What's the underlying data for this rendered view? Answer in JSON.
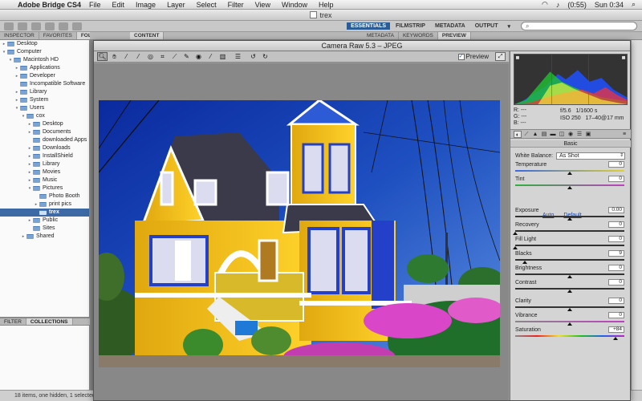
{
  "menubar": {
    "app": "Adobe Bridge CS4",
    "items": [
      "File",
      "Edit",
      "Image",
      "Layer",
      "Select",
      "Filter",
      "View",
      "Window",
      "Help"
    ],
    "battery": "(0:55)",
    "clock": "Sun 0:34"
  },
  "bridge": {
    "window_title": "trex",
    "workspaces": [
      "ESSENTIALS",
      "FILMSTRIP",
      "METADATA",
      "OUTPUT"
    ],
    "search_placeholder": "",
    "left_tabs": [
      "INSPECTOR",
      "FAVORITES",
      "FOLDERS"
    ],
    "content_tab": "CONTENT",
    "right_tabs": [
      "METADATA",
      "KEYWORDS",
      "PREVIEW"
    ],
    "bottom_tabs": [
      "FILTER",
      "COLLECTIONS"
    ],
    "status": "18 items, one hidden, 1 selected -"
  },
  "folders": [
    {
      "label": "Desktop",
      "depth": 0,
      "tri": "▸"
    },
    {
      "label": "Computer",
      "depth": 0,
      "tri": "▾"
    },
    {
      "label": "Macintosh HD",
      "depth": 1,
      "tri": "▾"
    },
    {
      "label": "Applications",
      "depth": 2,
      "tri": "▸"
    },
    {
      "label": "Developer",
      "depth": 2,
      "tri": "▸"
    },
    {
      "label": "Incompatible Software",
      "depth": 2,
      "tri": ""
    },
    {
      "label": "Library",
      "depth": 2,
      "tri": "▸"
    },
    {
      "label": "System",
      "depth": 2,
      "tri": "▸"
    },
    {
      "label": "Users",
      "depth": 2,
      "tri": "▾"
    },
    {
      "label": "cox",
      "depth": 3,
      "tri": "▾"
    },
    {
      "label": "Desktop",
      "depth": 4,
      "tri": "▸"
    },
    {
      "label": "Documents",
      "depth": 4,
      "tri": "▸"
    },
    {
      "label": "downloaded Apps",
      "depth": 4,
      "tri": ""
    },
    {
      "label": "Downloads",
      "depth": 4,
      "tri": "▸"
    },
    {
      "label": "InstallShield",
      "depth": 4,
      "tri": "▸"
    },
    {
      "label": "Library",
      "depth": 4,
      "tri": "▸"
    },
    {
      "label": "Movies",
      "depth": 4,
      "tri": "▸"
    },
    {
      "label": "Music",
      "depth": 4,
      "tri": "▸"
    },
    {
      "label": "Pictures",
      "depth": 4,
      "tri": "▾"
    },
    {
      "label": "Photo Booth",
      "depth": 5,
      "tri": ""
    },
    {
      "label": "print pics",
      "depth": 5,
      "tri": "▸"
    },
    {
      "label": "trex",
      "depth": 5,
      "tri": "",
      "selected": true
    },
    {
      "label": "Public",
      "depth": 4,
      "tri": "▸"
    },
    {
      "label": "Sites",
      "depth": 4,
      "tri": ""
    },
    {
      "label": "Shared",
      "depth": 3,
      "tri": "▸"
    }
  ],
  "camera_raw": {
    "title": "Camera Raw 5.3  –  JPEG",
    "preview_label": "Preview",
    "tools": [
      "zoom",
      "hand",
      "white-balance",
      "color-sampler",
      "target-adjust",
      "crop",
      "straighten",
      "spot-removal",
      "red-eye",
      "adjustment-brush",
      "graduated-filter",
      "preferences",
      "rotate-ccw",
      "rotate-cw"
    ],
    "readout": {
      "r": "R:  ---",
      "g": "G:  ---",
      "b": "B:  ---",
      "aperture": "f/5.6",
      "shutter": "1/1600 s",
      "iso": "ISO 250",
      "lens": "17–40@17 mm"
    },
    "panel_title": "Basic",
    "white_balance_label": "White Balance:",
    "white_balance_value": "As Shot",
    "auto": "Auto",
    "default": "Default",
    "sliders": [
      {
        "label": "Temperature",
        "value": "0",
        "fraction": 0.5
      },
      {
        "label": "Tint",
        "value": "0",
        "fraction": 0.5
      },
      {
        "label": "Exposure",
        "value": "0.00",
        "fraction": 0.5
      },
      {
        "label": "Recovery",
        "value": "0",
        "fraction": 0.0
      },
      {
        "label": "Fill Light",
        "value": "0",
        "fraction": 0.0
      },
      {
        "label": "Blacks",
        "value": "9",
        "fraction": 0.09
      },
      {
        "label": "Brightness",
        "value": "0",
        "fraction": 0.5
      },
      {
        "label": "Contrast",
        "value": "0",
        "fraction": 0.5
      },
      {
        "label": "Clarity",
        "value": "0",
        "fraction": 0.5
      },
      {
        "label": "Vibrance",
        "value": "0",
        "fraction": 0.5
      },
      {
        "label": "Saturation",
        "value": "+84",
        "fraction": 0.92
      }
    ]
  },
  "colors": {
    "selection": "#3d6aa5",
    "house_yellow": "#f5c518",
    "sky": "#1e4fc0"
  }
}
